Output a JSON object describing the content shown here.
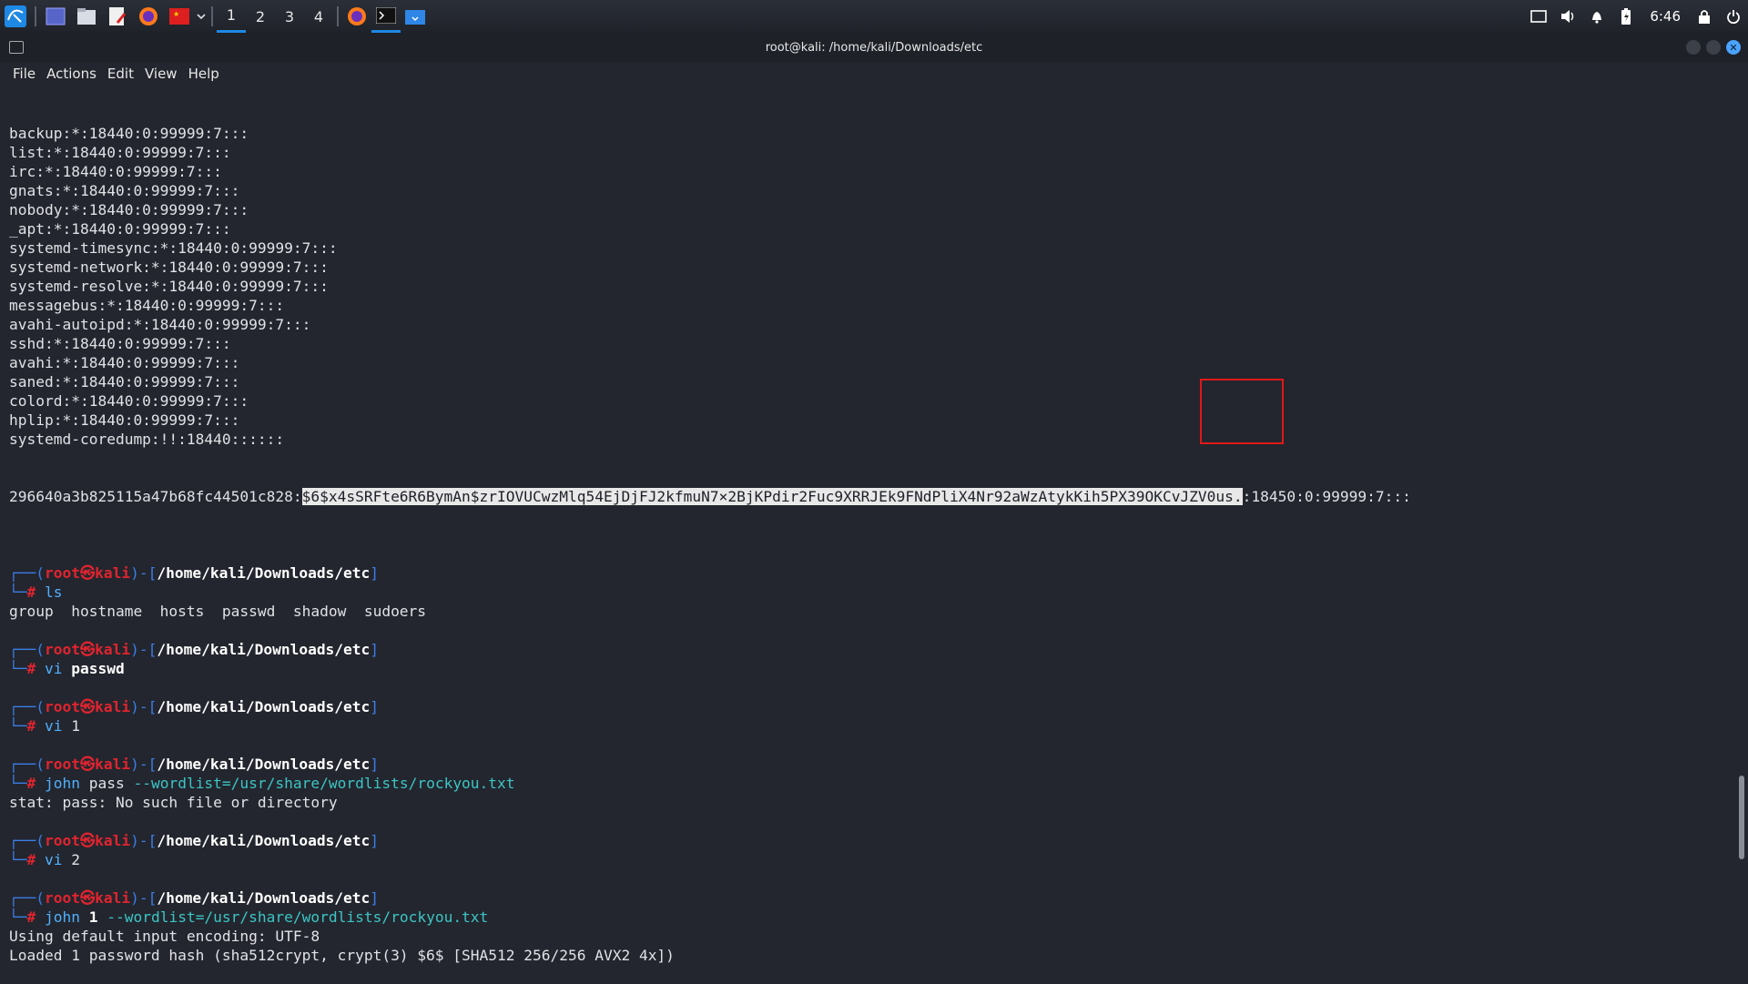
{
  "panel": {
    "workspaces": [
      "1",
      "2",
      "3",
      "4"
    ],
    "active_workspace": "1",
    "clock": "6:46",
    "icons": [
      "kali-menu-icon",
      "desktop-icon",
      "files-icon",
      "text-editor-icon",
      "firefox-icon",
      "flag-icon",
      "chevron-down-icon",
      "firefox-task-icon",
      "terminal-task-icon",
      "files-task-icon"
    ],
    "tray_icons": [
      "display-icon",
      "volume-icon",
      "bell-icon",
      "battery-icon",
      "lock-icon",
      "power-icon"
    ]
  },
  "window": {
    "title": "root@kali: /home/kali/Downloads/etc",
    "menu": [
      "File",
      "Actions",
      "Edit",
      "View",
      "Help"
    ]
  },
  "terminal": {
    "shadow_lines": [
      "backup:*:18440:0:99999:7:::",
      "list:*:18440:0:99999:7:::",
      "irc:*:18440:0:99999:7:::",
      "gnats:*:18440:0:99999:7:::",
      "nobody:*:18440:0:99999:7:::",
      "_apt:*:18440:0:99999:7:::",
      "systemd-timesync:*:18440:0:99999:7:::",
      "systemd-network:*:18440:0:99999:7:::",
      "systemd-resolve:*:18440:0:99999:7:::",
      "messagebus:*:18440:0:99999:7:::",
      "avahi-autoipd:*:18440:0:99999:7:::",
      "sshd:*:18440:0:99999:7:::",
      "avahi:*:18440:0:99999:7:::",
      "saned:*:18440:0:99999:7:::",
      "colord:*:18440:0:99999:7:::",
      "hplip:*:18440:0:99999:7:::",
      "systemd-coredump:!!:18440::::::"
    ],
    "hash_line": {
      "user": "296640a3b825115a47b68fc44501c828:",
      "hash": "$6$x4sSRFte6R6BymAn$zrIOVUCwzMlq54EjDjFJ2kfmuN7×2BjKPdir2Fuc9XRRJEk9FNdPliX4Nr92aWzAtykKih5PX39OKCvJZV0us.",
      "rest": ":18450:0:99999:7:::"
    },
    "prompt": {
      "top_left": "┌──(",
      "user": "root㉿kali",
      "mid": ")-[",
      "path": "/home/kali/Downloads/etc",
      "end": "]",
      "bottom_left": "└─",
      "hash": "#"
    },
    "commands": [
      {
        "name": "ls",
        "args": "",
        "bold": "",
        "path": "",
        "output": [
          "group  hostname  hosts  passwd  shadow  sudoers"
        ]
      },
      {
        "name": "vi",
        "args": "",
        "bold": "passwd",
        "path": "",
        "output": []
      },
      {
        "name": "vi",
        "args": "1",
        "bold": "",
        "path": "",
        "output": []
      },
      {
        "name": "john",
        "args": "pass",
        "bold": "",
        "path": "--wordlist=/usr/share/wordlists/rockyou.txt",
        "output": [
          "stat: pass: No such file or directory"
        ]
      },
      {
        "name": "vi",
        "args": "2",
        "bold": "",
        "path": "",
        "output": []
      },
      {
        "name": "john",
        "args": "",
        "bold": "1",
        "path": "--wordlist=/usr/share/wordlists/rockyou.txt",
        "output": [
          "Using default input encoding: UTF-8",
          "Loaded 1 password hash (sha512crypt, crypt(3) $6$ [SHA512 256/256 AVX2 4x])"
        ]
      }
    ]
  },
  "colors": {
    "accent": "#1e88e5",
    "prompt_frame": "#3b7ee8",
    "prompt_user": "#e0242f",
    "highlight_box": "#e01818"
  }
}
